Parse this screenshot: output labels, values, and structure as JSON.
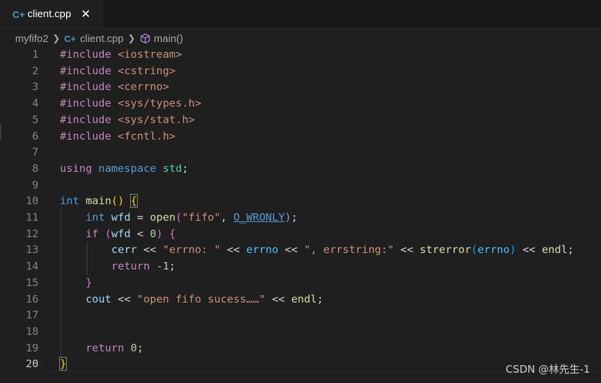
{
  "tab": {
    "icon": "cpp-file-icon",
    "icon_glyph": "C+",
    "label": "client.cpp",
    "close": "✕"
  },
  "breadcrumb": {
    "folder": "myfifo2",
    "file": "client.cpp",
    "symbol": "main()"
  },
  "lines": [
    {
      "n": "1",
      "tokens": [
        [
          "#include",
          "pp"
        ],
        [
          " ",
          "plain"
        ],
        [
          "<iostream>",
          "inc"
        ]
      ]
    },
    {
      "n": "2",
      "tokens": [
        [
          "#include",
          "pp"
        ],
        [
          " ",
          "plain"
        ],
        [
          "<cstring>",
          "inc"
        ]
      ]
    },
    {
      "n": "3",
      "tokens": [
        [
          "#include",
          "pp"
        ],
        [
          " ",
          "plain"
        ],
        [
          "<cerrno>",
          "inc"
        ]
      ]
    },
    {
      "n": "4",
      "tokens": [
        [
          "#include",
          "pp"
        ],
        [
          " ",
          "plain"
        ],
        [
          "<sys/types.h>",
          "inc"
        ]
      ]
    },
    {
      "n": "5",
      "tokens": [
        [
          "#include",
          "pp"
        ],
        [
          " ",
          "plain"
        ],
        [
          "<sys/stat.h>",
          "inc"
        ]
      ]
    },
    {
      "n": "6",
      "tokens": [
        [
          "#include",
          "pp"
        ],
        [
          " ",
          "plain"
        ],
        [
          "<fcntl.h>",
          "inc"
        ]
      ]
    },
    {
      "n": "7",
      "tokens": []
    },
    {
      "n": "8",
      "tokens": [
        [
          "using",
          "kw"
        ],
        [
          " ",
          "plain"
        ],
        [
          "namespace",
          "type"
        ],
        [
          " ",
          "plain"
        ],
        [
          "std",
          "ns"
        ],
        [
          ";",
          "plain"
        ]
      ]
    },
    {
      "n": "9",
      "tokens": []
    },
    {
      "n": "10",
      "tokens": [
        [
          "int",
          "type"
        ],
        [
          " ",
          "plain"
        ],
        [
          "main",
          "fn"
        ],
        [
          "()",
          "b1"
        ],
        [
          " ",
          "plain"
        ],
        [
          "{",
          "b1box"
        ]
      ]
    },
    {
      "n": "11",
      "tokens": [
        [
          "    ",
          "plain"
        ],
        [
          "int",
          "type"
        ],
        [
          " ",
          "plain"
        ],
        [
          "wfd",
          "var"
        ],
        [
          " = ",
          "op"
        ],
        [
          "open",
          "fn"
        ],
        [
          "(",
          "b2"
        ],
        [
          "\"fifo\"",
          "str"
        ],
        [
          ", ",
          "plain"
        ],
        [
          "O_WRONLY",
          "macu"
        ],
        [
          ")",
          "b2"
        ],
        [
          ";",
          "plain"
        ]
      ]
    },
    {
      "n": "12",
      "tokens": [
        [
          "    ",
          "plain"
        ],
        [
          "if",
          "kw"
        ],
        [
          " ",
          "plain"
        ],
        [
          "(",
          "b2"
        ],
        [
          "wfd",
          "var"
        ],
        [
          " < ",
          "op"
        ],
        [
          "0",
          "num"
        ],
        [
          ")",
          "b2"
        ],
        [
          " ",
          "plain"
        ],
        [
          "{",
          "b2"
        ]
      ]
    },
    {
      "n": "13",
      "tokens": [
        [
          "        ",
          "plain"
        ],
        [
          "cerr",
          "var"
        ],
        [
          " << ",
          "op"
        ],
        [
          "\"errno: \"",
          "str"
        ],
        [
          " << ",
          "op"
        ],
        [
          "errno",
          "mac"
        ],
        [
          " << ",
          "op"
        ],
        [
          "\", errstring:\"",
          "str"
        ],
        [
          " << ",
          "op"
        ],
        [
          "strerror",
          "fn"
        ],
        [
          "(",
          "b3"
        ],
        [
          "errno",
          "mac"
        ],
        [
          ")",
          "b3"
        ],
        [
          " << ",
          "op"
        ],
        [
          "endl",
          "fn"
        ],
        [
          ";",
          "plain"
        ]
      ]
    },
    {
      "n": "14",
      "tokens": [
        [
          "        ",
          "plain"
        ],
        [
          "return",
          "kw"
        ],
        [
          " ",
          "plain"
        ],
        [
          "-1",
          "num"
        ],
        [
          ";",
          "plain"
        ]
      ]
    },
    {
      "n": "15",
      "tokens": [
        [
          "    ",
          "plain"
        ],
        [
          "}",
          "b2"
        ]
      ]
    },
    {
      "n": "16",
      "tokens": [
        [
          "    ",
          "plain"
        ],
        [
          "cout",
          "var"
        ],
        [
          " << ",
          "op"
        ],
        [
          "\"open fifo sucess……\"",
          "str"
        ],
        [
          " << ",
          "op"
        ],
        [
          "endl",
          "fn"
        ],
        [
          ";",
          "plain"
        ]
      ]
    },
    {
      "n": "17",
      "tokens": []
    },
    {
      "n": "18",
      "tokens": []
    },
    {
      "n": "19",
      "tokens": [
        [
          "    ",
          "plain"
        ],
        [
          "return",
          "kw"
        ],
        [
          " ",
          "plain"
        ],
        [
          "0",
          "num"
        ],
        [
          ";",
          "plain"
        ]
      ]
    },
    {
      "n": "20",
      "tokens": [
        [
          "}",
          "b1box"
        ]
      ]
    }
  ],
  "active_line": "20",
  "watermark": "CSDN @林先生-1"
}
